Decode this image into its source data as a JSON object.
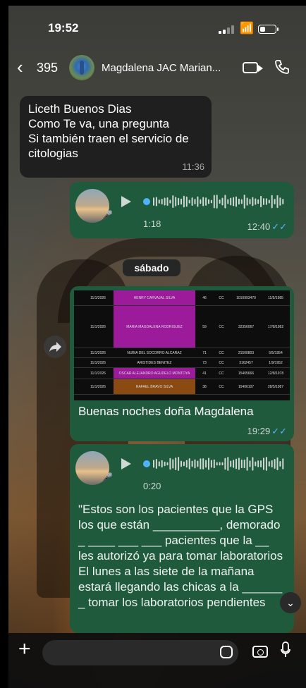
{
  "status": {
    "time": "19:52",
    "battery_level": 0.35
  },
  "header": {
    "back_count": "395",
    "contact_name": "Magdalena JAC Marian..."
  },
  "messages": {
    "m1": {
      "lines": [
        "Liceth Buenos Dias",
        "Como Te va, una pregunta",
        "Si también traen el servicio de",
        "citologias"
      ],
      "time": "11:36"
    },
    "voice1": {
      "duration": "1:18",
      "time": "12:40"
    },
    "day_separator": "sábado",
    "image_msg": {
      "caption": "Buenas noches  doña Magdalena",
      "time": "19:29",
      "table_rows": [
        {
          "date": "11/1/2026",
          "name": "HENRY CARVAJAL SILVA",
          "age": "46",
          "doc": "CC",
          "id": "1010993470",
          "dob": "11/5/1985",
          "color": "#9b1b9b"
        },
        {
          "date": "11/1/2026",
          "name": "MARIA MAGDALENA RODRIGUEZ",
          "age": "59",
          "doc": "CC",
          "id": "32356067",
          "dob": "17/8/1982",
          "color": "#9b1b9b"
        },
        {
          "date": "11/1/2026",
          "name": "NUBIA DEL SOCORRO ALCARAZ",
          "age": "71",
          "doc": "CC",
          "id": "21500803",
          "dob": "5/5/1954",
          "color": "#0d0d0d"
        },
        {
          "date": "11/1/2026",
          "name": "ARISTIDES BENITEZ",
          "age": "73",
          "doc": "CC",
          "id": "3162457",
          "dob": "1/9/1952",
          "color": "#0d0d0d"
        },
        {
          "date": "11/1/2026",
          "name": "OSCAR ALEJANDRO AGUDELO MONTOYA",
          "age": "41",
          "doc": "CC",
          "id": "15405666",
          "dob": "12/8/1978",
          "color": "#9b1b9b"
        },
        {
          "date": "11/1/2026",
          "name": "RAFAEL BRAVO SILVA",
          "age": "38",
          "doc": "CC",
          "id": "15406107",
          "dob": "28/5/1987",
          "color": "#8a4a12"
        }
      ]
    },
    "voice2": {
      "duration": "0:20",
      "transcript": "\"Estos son los pacientes que la GPS los que están __________, demorado _ ____ ___ ___ pacientes que la __ les autorizó ya para tomar laboratorios El lunes a las siete de la mañana estará llegando las chicas a la ______ _ tomar los laboratorios pendientes"
    }
  },
  "icons": {
    "back": "chevron-left-icon",
    "video": "video-call-icon",
    "call": "phone-icon",
    "forward": "forward-icon",
    "play": "play-icon",
    "mic": "mic-icon",
    "plus": "plus-icon",
    "sticker": "sticker-icon",
    "camera": "camera-icon",
    "scroll": "chevron-down-icon"
  },
  "colors": {
    "outgoing": "#1f5a3d",
    "incoming": "#1f1f1f",
    "read_ticks": "#5ab4ff",
    "accent_blue": "#4fb3ff"
  }
}
